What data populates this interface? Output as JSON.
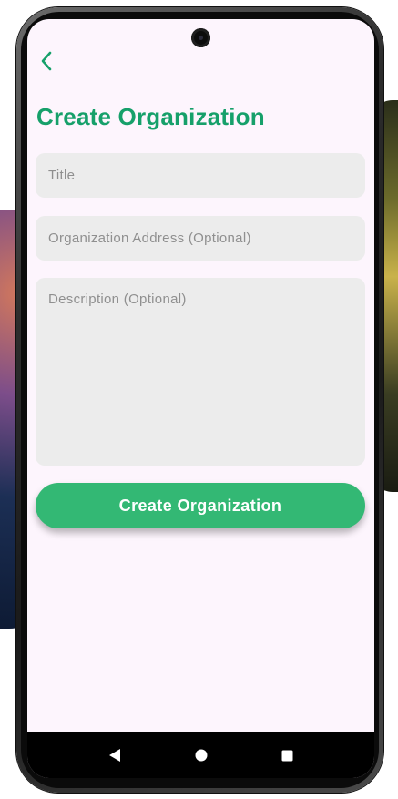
{
  "colors": {
    "accent": "#16a06a",
    "button": "#33b874",
    "field_background": "#ececec",
    "screen_background": "#fdf5fd"
  },
  "header": {
    "back_icon": "chevron-left-icon",
    "title": "Create Organization"
  },
  "form": {
    "title_placeholder": "Title",
    "address_placeholder": "Organization Address (Optional)",
    "description_placeholder": "Description (Optional)",
    "submit_label": "Create Organization"
  },
  "nav": {
    "back_icon": "triangle-back-icon",
    "home_icon": "circle-home-icon",
    "recents_icon": "square-recents-icon"
  }
}
